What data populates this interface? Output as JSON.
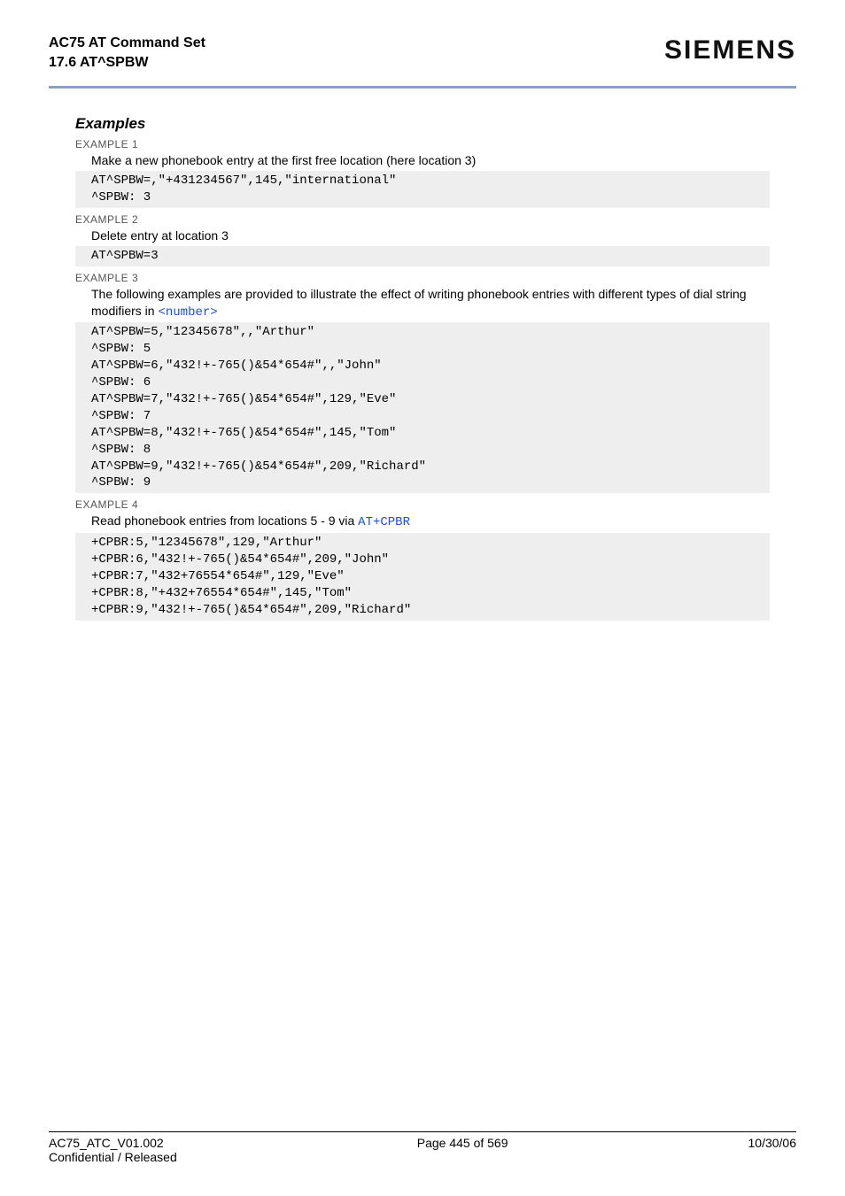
{
  "header": {
    "title": "AC75 AT Command Set",
    "subtitle": "17.6 AT^SPBW",
    "brand": "SIEMENS"
  },
  "section": {
    "title": "Examples"
  },
  "ex1": {
    "label": "EXAMPLE 1",
    "desc": "Make a new phonebook entry at the first free location (here location 3)",
    "code": "AT^SPBW=,\"+431234567\",145,\"international\"\n^SPBW: 3"
  },
  "ex2": {
    "label": "EXAMPLE 2",
    "desc": "Delete entry at location 3",
    "code": "AT^SPBW=3"
  },
  "ex3": {
    "label": "EXAMPLE 3",
    "desc_a": "The following examples are provided to illustrate the effect of writing phonebook entries with different types of dial string modifiers in ",
    "link": "<number>",
    "code": "AT^SPBW=5,\"12345678\",,\"Arthur\"\n^SPBW: 5\nAT^SPBW=6,\"432!+-765()&54*654#\",,\"John\"\n^SPBW: 6\nAT^SPBW=7,\"432!+-765()&54*654#\",129,\"Eve\"\n^SPBW: 7\nAT^SPBW=8,\"432!+-765()&54*654#\",145,\"Tom\"\n^SPBW: 8\nAT^SPBW=9,\"432!+-765()&54*654#\",209,\"Richard\"\n^SPBW: 9"
  },
  "ex4": {
    "label": "EXAMPLE 4",
    "desc_a": "Read phonebook entries from locations 5 - 9 via ",
    "link": "AT+CPBR",
    "code": "+CPBR:5,\"12345678\",129,\"Arthur\"\n+CPBR:6,\"432!+-765()&54*654#\",209,\"John\"\n+CPBR:7,\"432+76554*654#\",129,\"Eve\"\n+CPBR:8,\"+432+76554*654#\",145,\"Tom\"\n+CPBR:9,\"432!+-765()&54*654#\",209,\"Richard\""
  },
  "footer": {
    "left1": "AC75_ATC_V01.002",
    "left2": "Confidential / Released",
    "mid": "Page 445 of 569",
    "right": "10/30/06"
  }
}
